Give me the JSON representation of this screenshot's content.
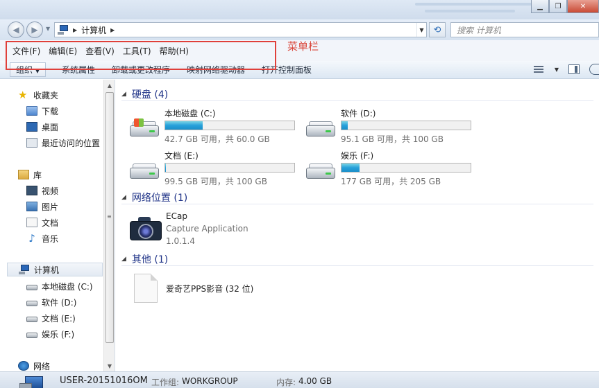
{
  "address_bar": {
    "breadcrumb": "计算机",
    "search_placeholder": "搜索 计算机"
  },
  "menu_bar": {
    "items": [
      "文件(F)",
      "编辑(E)",
      "查看(V)",
      "工具(T)",
      "帮助(H)"
    ],
    "annotation_label": "菜单栏",
    "annotation_color": "#e0403a"
  },
  "command_bar": {
    "organize": "组织",
    "items": [
      "系统属性",
      "卸载或更改程序",
      "映射网络驱动器",
      "打开控制面板"
    ]
  },
  "nav_pane": {
    "favorites": {
      "label": "收藏夹",
      "items": [
        "下载",
        "桌面",
        "最近访问的位置"
      ]
    },
    "libraries": {
      "label": "库",
      "items": [
        "视频",
        "图片",
        "文档",
        "音乐"
      ]
    },
    "computer": {
      "label": "计算机",
      "items": [
        "本地磁盘 (C:)",
        "软件 (D:)",
        "文档 (E:)",
        "娱乐 (F:)"
      ]
    },
    "network": {
      "label": "网络"
    }
  },
  "content": {
    "hard_disks": {
      "header": "硬盘 (4)",
      "drives": [
        {
          "name": "本地磁盘 (C:)",
          "free_text": "42.7 GB 可用，共 60.0 GB",
          "used_fraction": 0.29
        },
        {
          "name": "软件 (D:)",
          "free_text": "95.1 GB 可用，共 100 GB",
          "used_fraction": 0.05
        },
        {
          "name": "文档 (E:)",
          "free_text": "99.5 GB 可用，共 100 GB",
          "used_fraction": 0.005
        },
        {
          "name": "娱乐 (F:)",
          "free_text": "177 GB 可用，共 205 GB",
          "used_fraction": 0.14
        }
      ]
    },
    "network_locations": {
      "header": "网络位置 (1)",
      "app": {
        "name": "ECap",
        "description": "Capture Application",
        "version": "1.0.1.4"
      }
    },
    "other": {
      "header": "其他 (1)",
      "item": "爱奇艺PPS影音 (32 位)"
    }
  },
  "status_bar": {
    "hostname": "USER-20151016OM",
    "workgroup_label": "工作组:",
    "workgroup": "WORKGROUP",
    "memory_label": "内存:",
    "memory": "4.00 GB"
  }
}
